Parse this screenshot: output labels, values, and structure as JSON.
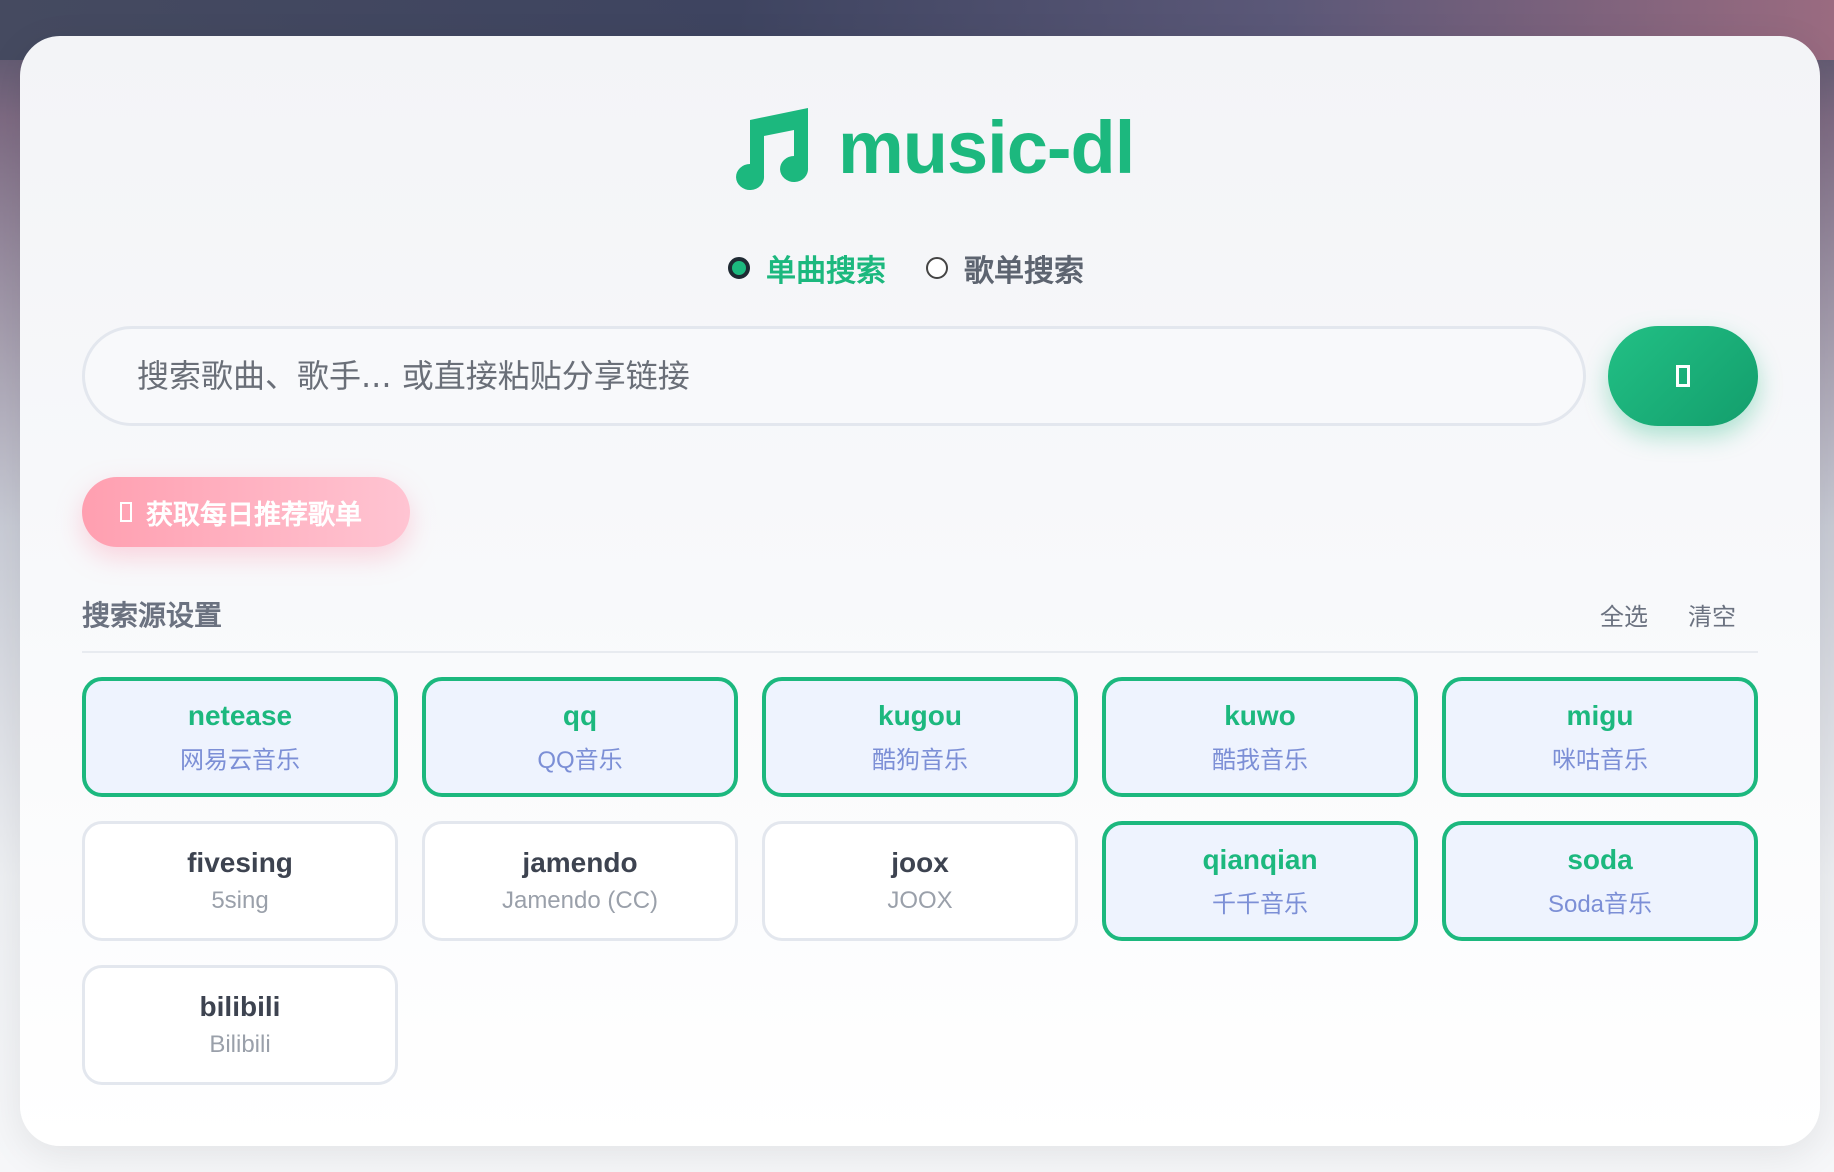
{
  "app": {
    "title": "music-dl",
    "accent_color": "#1cb87e"
  },
  "search_mode": {
    "options": [
      {
        "label": "单曲搜索",
        "selected": true
      },
      {
        "label": "歌单搜索",
        "selected": false
      }
    ]
  },
  "search": {
    "placeholder": "搜索歌曲、歌手... 或直接粘贴分享链接",
    "button_icon": "search-icon"
  },
  "daily": {
    "label": "获取每日推荐歌单",
    "icon": "calendar-icon"
  },
  "sources": {
    "title": "搜索源设置",
    "select_all": "全选",
    "clear": "清空",
    "items": [
      {
        "key": "netease",
        "name": "网易云音乐",
        "selected": true
      },
      {
        "key": "qq",
        "name": "QQ音乐",
        "selected": true
      },
      {
        "key": "kugou",
        "name": "酷狗音乐",
        "selected": true
      },
      {
        "key": "kuwo",
        "name": "酷我音乐",
        "selected": true
      },
      {
        "key": "migu",
        "name": "咪咕音乐",
        "selected": true
      },
      {
        "key": "fivesing",
        "name": "5sing",
        "selected": false
      },
      {
        "key": "jamendo",
        "name": "Jamendo (CC)",
        "selected": false
      },
      {
        "key": "joox",
        "name": "JOOX",
        "selected": false
      },
      {
        "key": "qianqian",
        "name": "千千音乐",
        "selected": true
      },
      {
        "key": "soda",
        "name": "Soda音乐",
        "selected": true
      },
      {
        "key": "bilibili",
        "name": "Bilibili",
        "selected": false
      }
    ]
  }
}
